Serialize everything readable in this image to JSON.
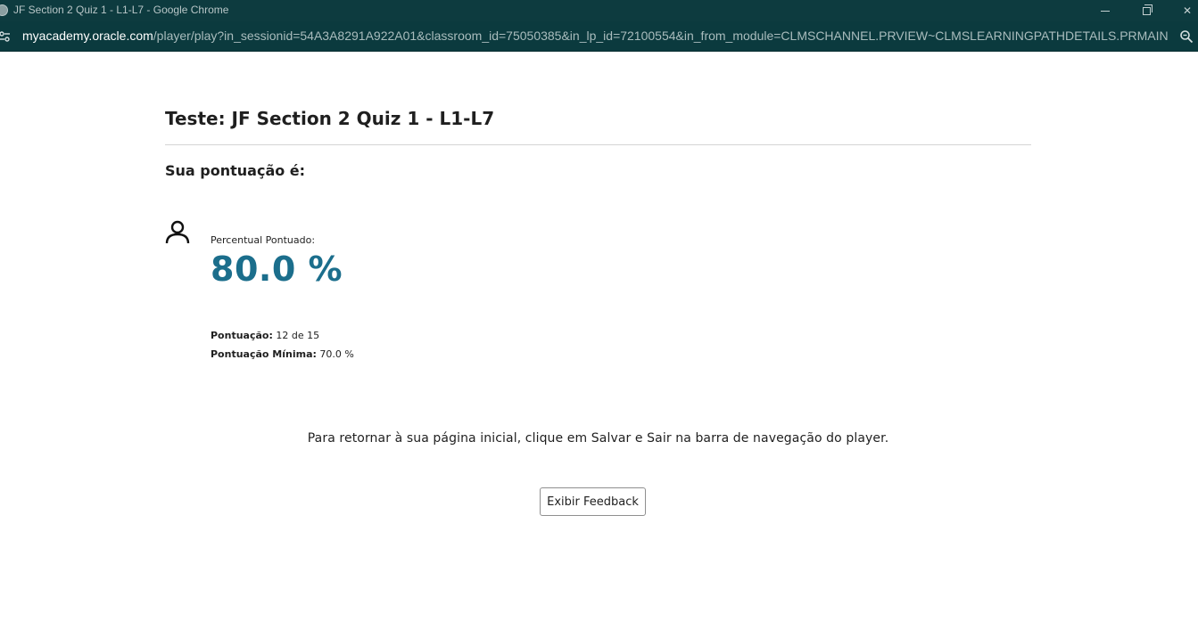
{
  "window": {
    "title": "JF Section 2 Quiz 1 - L1-L7 - Google Chrome"
  },
  "address_bar": {
    "host": "myacademy.oracle.com",
    "path": "/player/play?in_sessionid=54A3A8291A922A01&classroom_id=75050385&in_lp_id=72100554&in_from_module=CLMSCHANNEL.PRVIEW~CLMSLEARNINGPATHDETAILS.PRMAIN&in_f..."
  },
  "quiz": {
    "title": "Teste: JF Section 2 Quiz 1 - L1-L7",
    "score_heading": "Sua pontuação é:",
    "percent_label": "Percentual Pontuado:",
    "percent_value": "80.0 %",
    "score_label": "Pontuação:",
    "score_value": "12 de 15",
    "min_score_label": "Pontuação Mínima:",
    "min_score_value": "70.0 %",
    "instruction": "Para retornar à sua página inicial, clique em Salvar e Sair na barra de navegação do player.",
    "feedback_button": "Exibir Feedback"
  },
  "colors": {
    "titlebar_bg": "#0d3b3f",
    "accent_percent": "#1b6e8c"
  },
  "icons": {
    "app": "chrome-icon",
    "site_info": "site-info-icon",
    "zoom": "zoom-icon",
    "user": "user-icon"
  }
}
